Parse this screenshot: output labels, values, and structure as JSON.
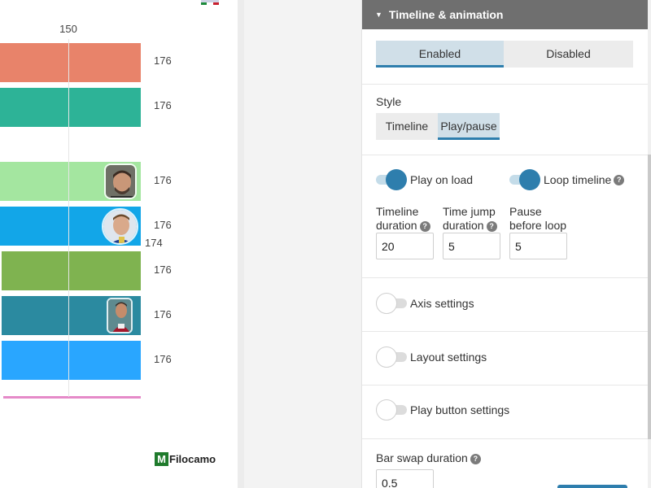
{
  "chart": {
    "axis_tick": "150",
    "bars": [
      {
        "color": "#e8836a",
        "value": "176"
      },
      {
        "color": "#2db397",
        "value": "176"
      },
      {
        "color": "#a4e6a0",
        "value": "176"
      },
      {
        "color": "#12a6e8",
        "value": "176",
        "secondary_value": "174"
      },
      {
        "color": "#7fb350",
        "value": "176"
      },
      {
        "color": "#2b8aa0",
        "value": "176"
      },
      {
        "color": "#29a6ff",
        "value": "176"
      }
    ],
    "logo": {
      "mark": "M",
      "text": "Filocamo"
    }
  },
  "panel": {
    "header": "Timeline & animation",
    "enabled_segment": {
      "options": [
        "Enabled",
        "Disabled"
      ],
      "selected": "Enabled"
    },
    "style_label": "Style",
    "style_segment": {
      "options": [
        "Timeline",
        "Play/pause"
      ],
      "selected": "Play/pause"
    },
    "play_on_load": {
      "label": "Play on load",
      "on": true
    },
    "loop_timeline": {
      "label": "Loop timeline",
      "on": true
    },
    "fields": [
      {
        "line1": "Timeline",
        "line2": "duration",
        "help": true,
        "value": "20"
      },
      {
        "line1": "Time jump",
        "line2": "duration",
        "help": true,
        "value": "5"
      },
      {
        "line1": "Pause",
        "line2": "before loop",
        "help": false,
        "value": "5"
      }
    ],
    "axis_settings": {
      "label": "Axis settings",
      "on": false
    },
    "layout_settings": {
      "label": "Layout settings",
      "on": false
    },
    "play_button_settings": {
      "label": "Play button settings",
      "on": false
    },
    "bar_swap": {
      "label": "Bar swap duration",
      "value": "0.5"
    },
    "help_glyph": "?",
    "caret_glyph": "▼"
  },
  "colors": {
    "accent": "#2e7ead",
    "header_bg": "#6f6f6f"
  }
}
